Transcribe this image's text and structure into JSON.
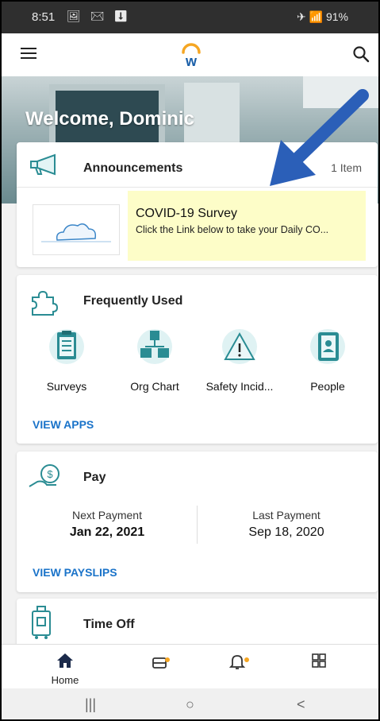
{
  "status_bar": {
    "time": "8:51",
    "left_icons": "🖼 ✉ ⬇",
    "right_text": "✈ 📶 91%"
  },
  "app_bar": {
    "menu_icon": "hamburger-icon",
    "logo_letter": "w",
    "search_icon": "search-icon"
  },
  "hero": {
    "welcome": "Welcome, Dominic"
  },
  "announcements": {
    "title": "Announcements",
    "count": "1 Item",
    "item_title": "COVID-19 Survey",
    "item_desc": "Click the Link below to take your Daily CO..."
  },
  "frequently_used": {
    "title": "Frequently Used",
    "apps": [
      {
        "label": "Surveys",
        "icon": "clipboard-icon"
      },
      {
        "label": "Org Chart",
        "icon": "org-chart-icon"
      },
      {
        "label": "Safety Incid...",
        "icon": "warning-icon"
      },
      {
        "label": "People",
        "icon": "people-icon"
      }
    ],
    "link": "VIEW APPS"
  },
  "pay": {
    "title": "Pay",
    "next_label": "Next Payment",
    "next_value": "Jan 22, 2021",
    "last_label": "Last Payment",
    "last_value": "Sep 18, 2020",
    "link": "VIEW PAYSLIPS"
  },
  "time_off": {
    "title": "Time Off"
  },
  "bottom_nav": {
    "items": [
      {
        "label": "Home",
        "icon": "home-icon"
      },
      {
        "label": "",
        "icon": "inbox-icon"
      },
      {
        "label": "",
        "icon": "bell-icon"
      },
      {
        "label": "",
        "icon": "apps-grid-icon"
      }
    ]
  },
  "system_nav": {
    "recents": "|||",
    "home": "○",
    "back": "<"
  },
  "colors": {
    "accent": "#1a73c9",
    "teal": "#2a8c93",
    "highlight": "#fdfdc8",
    "notification": "#f5a623"
  }
}
